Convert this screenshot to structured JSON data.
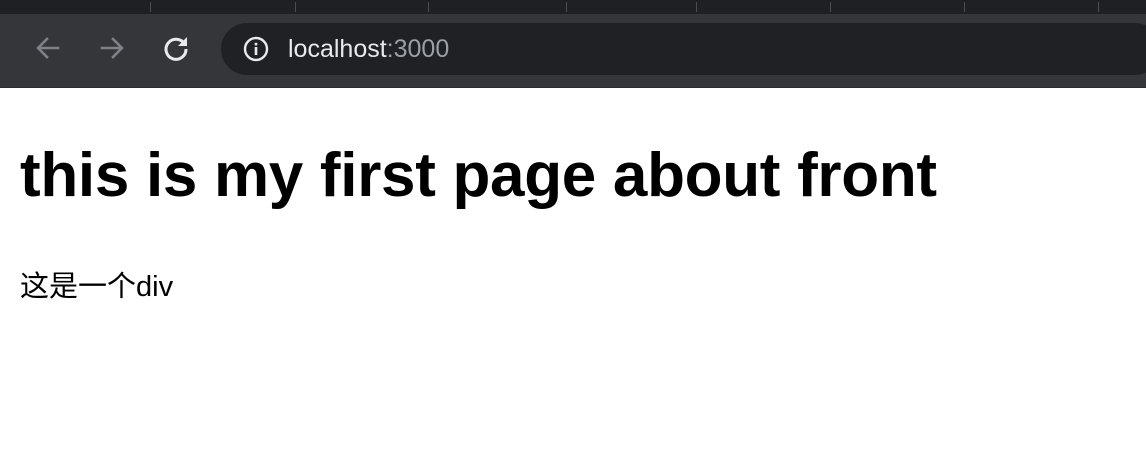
{
  "browser": {
    "toolbar": {
      "back_icon": "arrow-left",
      "forward_icon": "arrow-right",
      "reload_icon": "reload",
      "site_info_icon": "info-circle"
    },
    "address_bar": {
      "host": "localhost",
      "port": ":3000"
    }
  },
  "page": {
    "heading": "this is my first page about front",
    "div_text": "这是一个div"
  },
  "colors": {
    "toolbar_bg": "#35363a",
    "omnibox_bg": "#202124",
    "url_host": "#e8eaed",
    "url_port": "#9aa0a6",
    "page_bg": "#ffffff",
    "text": "#000000"
  }
}
